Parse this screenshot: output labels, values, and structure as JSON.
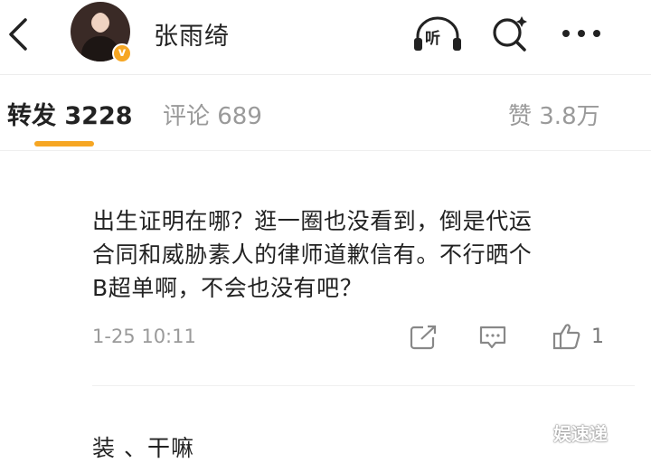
{
  "header": {
    "username": "张雨绮",
    "verified_badge": "v",
    "listen_label": "听",
    "accent_color": "#f6a623"
  },
  "tabs": {
    "repost": "转发 3228",
    "comment": "评论 689",
    "like": "赞 3.8万"
  },
  "post": {
    "lines": [
      "出生证明在哪？逛一圈也没看到，倒是代运",
      "合同和威胁素人的律师道歉信有。不行晒个",
      "B超单啊，不会也没有吧？"
    ],
    "timestamp": "1-25 10:11",
    "like_count": "1"
  },
  "next_item": {
    "text": "装  、干嘛"
  },
  "watermark": "娱速递",
  "icons": [
    "back-arrow-icon",
    "headphones-icon",
    "search-icon",
    "more-icon",
    "share-icon",
    "comment-icon",
    "thumbs-up-icon"
  ]
}
